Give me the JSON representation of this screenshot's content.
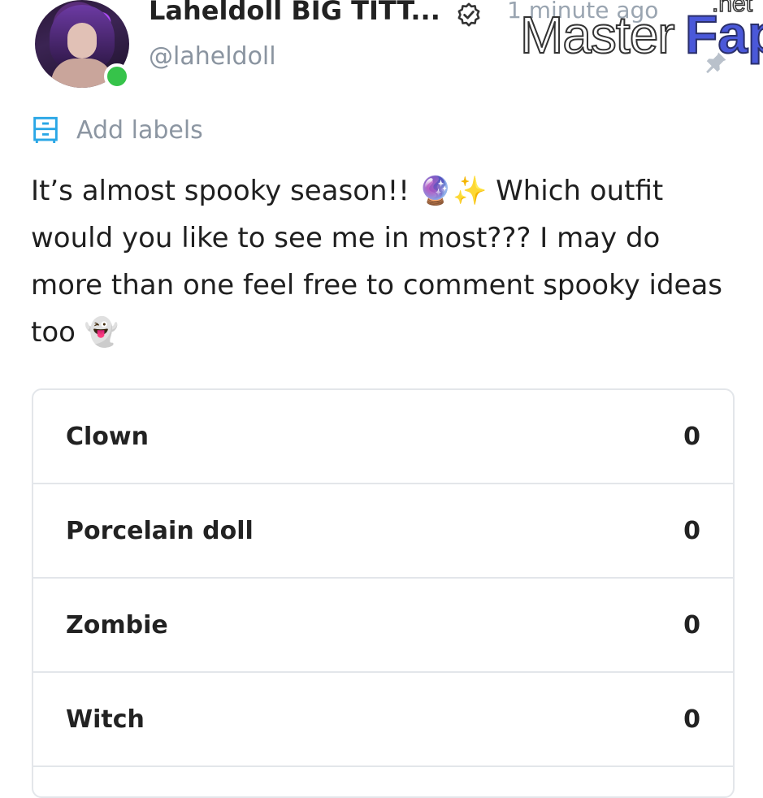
{
  "post": {
    "author_name": "Laheldoll BIG TITT...",
    "handle": "@laheldoll",
    "timestamp": "1 minute ago",
    "add_labels": "Add labels",
    "text": "It’s almost spooky season!! 🔮✨ Which outfit would you like to see me in most??? I may do more than one feel free to comment spooky ideas too 👻"
  },
  "watermark": {
    "master": "Master",
    "fap": "Fap",
    "net": ".net"
  },
  "poll": {
    "options": [
      {
        "label": "Clown",
        "count": "0"
      },
      {
        "label": "Porcelain doll",
        "count": "0"
      },
      {
        "label": "Zombie",
        "count": "0"
      },
      {
        "label": "Witch",
        "count": "0"
      }
    ]
  },
  "colors": {
    "online": "#36c34a",
    "accent": "#2aa7e6",
    "muted": "#8c96a2"
  },
  "icons": {
    "verified": "verified-icon",
    "labels": "labels-icon",
    "pin": "pin-icon"
  }
}
